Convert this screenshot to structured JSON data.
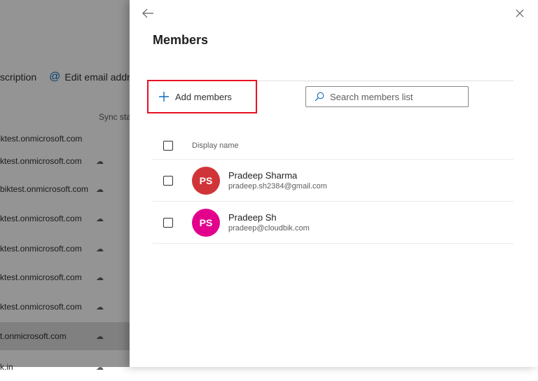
{
  "background": {
    "toolbar": {
      "partial_label": "scription",
      "edit_email_label": "Edit email addre"
    },
    "sync_header": "Sync stat",
    "rows": [
      "iktest.onmicrosoft.com",
      "ktest.onmicrosoft.com",
      "biktest.onmicrosoft.com",
      "ktest.onmicrosoft.com",
      "ktest.onmicrosoft.com",
      "ktest.onmicrosoft.com",
      "ktest.onmicrosoft.com",
      "t.onmicrosoft.com",
      "k.in"
    ]
  },
  "panel": {
    "title": "Members",
    "add_members_label": "Add members",
    "search_placeholder": "Search members list",
    "header_display_name": "Display name",
    "members": [
      {
        "initials": "PS",
        "name": "Pradeep Sharma",
        "email": "pradeep.sh2384@gmail.com",
        "avatar_color": "#d13438"
      },
      {
        "initials": "PS",
        "name": "Pradeep Sh",
        "email": "pradeep@cloudbik.com",
        "avatar_color": "#e3008c"
      }
    ]
  },
  "colors": {
    "accent": "#0f6cbd",
    "highlight_border": "#e81123"
  }
}
